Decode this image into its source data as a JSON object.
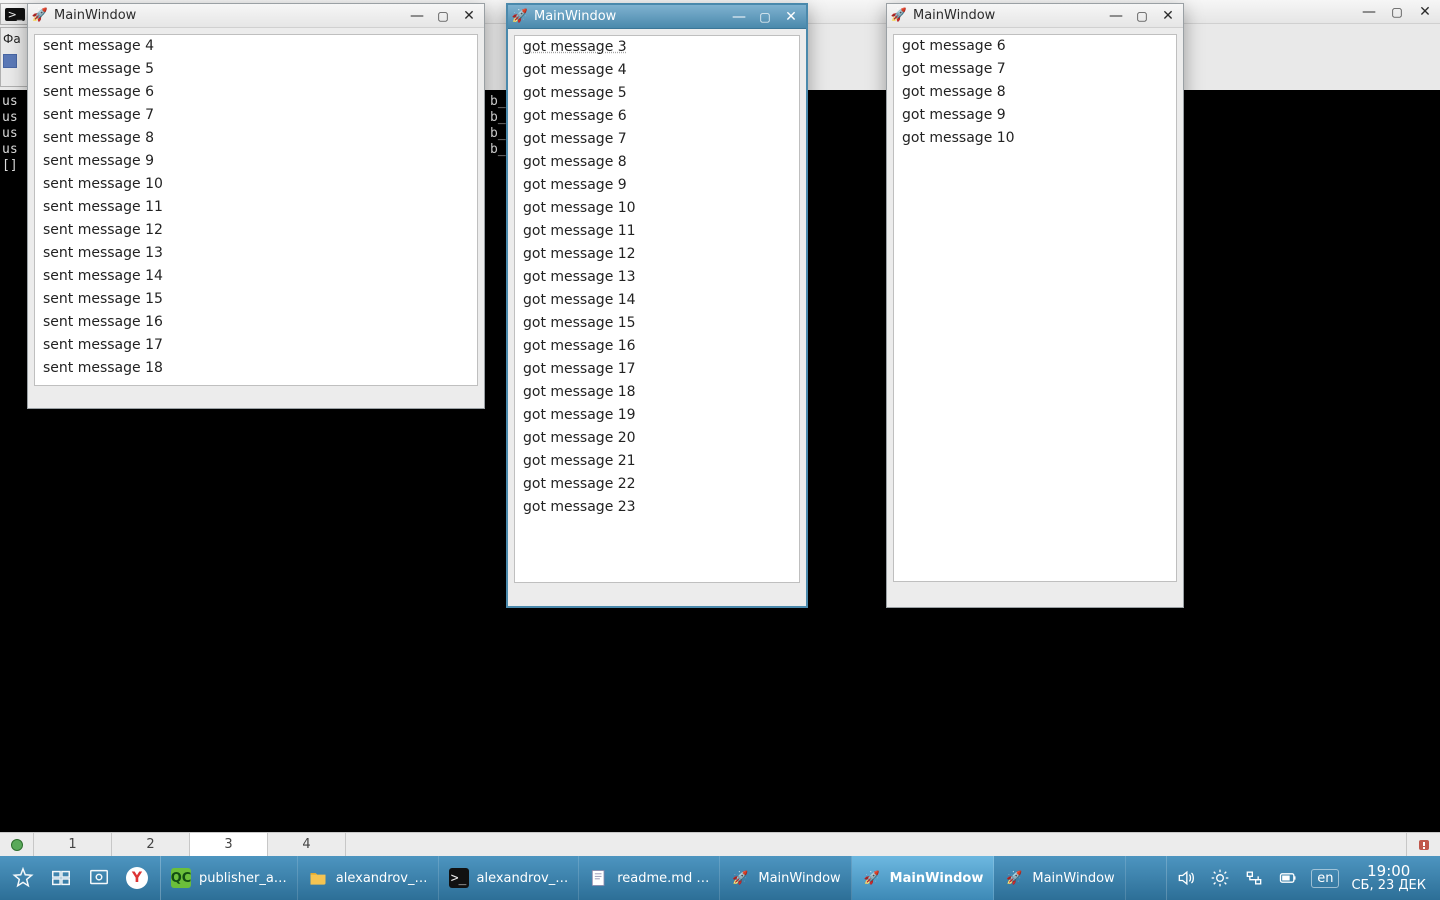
{
  "background": {
    "menu_label": "Фа"
  },
  "windows": {
    "left": {
      "title": "MainWindow",
      "items": [
        "sent message 4",
        "sent message 5",
        "sent message 6",
        "sent message 7",
        "sent message 8",
        "sent message 9",
        "sent message 10",
        "sent message 11",
        "sent message 12",
        "sent message 13",
        "sent message 14",
        "sent message 15",
        "sent message 16",
        "sent message 17",
        "sent message 18"
      ]
    },
    "mid": {
      "title": "MainWindow",
      "items": [
        "got message 3",
        "got message 4",
        "got message 5",
        "got message 6",
        "got message 7",
        "got message 8",
        "got message 9",
        "got message 10",
        "got message 11",
        "got message 12",
        "got message 13",
        "got message 14",
        "got message 15",
        "got message 16",
        "got message 17",
        "got message 18",
        "got message 19",
        "got message 20",
        "got message 21",
        "got message 22",
        "got message 23"
      ]
    },
    "right": {
      "title": "MainWindow",
      "items": [
        "got message 6",
        "got message 7",
        "got message 8",
        "got message 9",
        "got message 10"
      ]
    }
  },
  "terminal_peek_lines": [
    "us",
    "us",
    "us",
    "us",
    "[]"
  ],
  "pager": {
    "cells": [
      "1",
      "2",
      "3",
      "4"
    ],
    "active_index": 2
  },
  "taskbar": {
    "apps": [
      {
        "icon": "qc",
        "label": "publisher_a…"
      },
      {
        "icon": "folder",
        "label": "alexandrov_…"
      },
      {
        "icon": "terminal",
        "label": "alexandrov_…"
      },
      {
        "icon": "texteditor",
        "label": "readme.md …"
      },
      {
        "icon": "rocket",
        "label": "MainWindow"
      },
      {
        "icon": "rocket",
        "label": "MainWindow",
        "active": true
      },
      {
        "icon": "rocket",
        "label": "MainWindow"
      }
    ],
    "lang": "en",
    "clock": {
      "time": "19:00",
      "date": "СБ, 23 ДЕК"
    }
  }
}
